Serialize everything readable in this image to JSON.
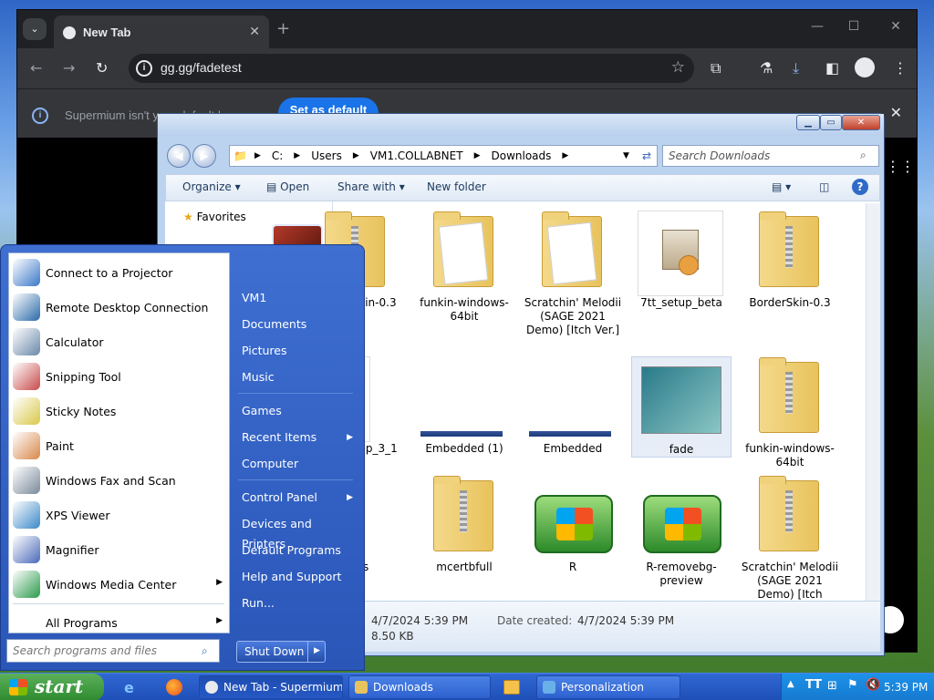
{
  "browser": {
    "tab_title": "New Tab",
    "url": "gg.gg/fadetest",
    "infobar_text": "Supermium isn't your default browser",
    "infobar_button": "Set as default"
  },
  "explorer": {
    "address": [
      "C:",
      "Users",
      "VM1.COLLABNET",
      "Downloads"
    ],
    "search_placeholder": "Search Downloads",
    "commands": {
      "organize": "Organize",
      "open": "Open",
      "share": "Share with",
      "new_folder": "New folder"
    },
    "nav_favorites": "Favorites",
    "files": [
      {
        "name": "BorderSkin-0.3",
        "kind": "zip"
      },
      {
        "name": "funkin-windows-64bit",
        "kind": "pages"
      },
      {
        "name": "Scratchin' Melodii (SAGE 2021 Demo) [Itch Ver.]",
        "kind": "pages"
      },
      {
        "name": "7tt_setup_beta",
        "kind": "setup"
      },
      {
        "name": "BorderSkin-0.3",
        "kind": "zip"
      },
      {
        "name": "ShellSetup_3_1",
        "kind": "shell"
      },
      {
        "name": "Embedded (1)",
        "kind": "bar"
      },
      {
        "name": "Embedded",
        "kind": "bar"
      },
      {
        "name": "fade",
        "kind": "image"
      },
      {
        "name": "funkin-windows-64bit",
        "kind": "zip"
      },
      {
        "name": "ages",
        "kind": "start"
      },
      {
        "name": "mcertbfull",
        "kind": "zip"
      },
      {
        "name": "R",
        "kind": "winlogo"
      },
      {
        "name": "R-removebg-preview",
        "kind": "winlogo"
      },
      {
        "name": "Scratchin' Melodii (SAGE 2021 Demo) [Itch",
        "kind": "zip"
      }
    ],
    "details": {
      "modified": "4/7/2024 5:39 PM",
      "size": "8.50 KB",
      "created_label": "Date created:",
      "created": "4/7/2024 5:39 PM"
    }
  },
  "startmenu": {
    "programs": [
      {
        "label": "Connect to a Projector",
        "color": "#3a78c8"
      },
      {
        "label": "Remote Desktop Connection",
        "color": "#2a6aa8"
      },
      {
        "label": "Calculator",
        "color": "#6a88a8"
      },
      {
        "label": "Snipping Tool",
        "color": "#c84a4a"
      },
      {
        "label": "Sticky Notes",
        "color": "#d8c84a"
      },
      {
        "label": "Paint",
        "color": "#d8884a"
      },
      {
        "label": "Windows Fax and Scan",
        "color": "#7a8a9a"
      },
      {
        "label": "XPS Viewer",
        "color": "#3a88c8"
      },
      {
        "label": "Magnifier",
        "color": "#4a6ab8"
      },
      {
        "label": "Windows Media Center",
        "color": "#2a9a4a"
      }
    ],
    "all_programs": "All Programs",
    "search_placeholder": "Search programs and files",
    "right": [
      "VM1",
      "Documents",
      "Pictures",
      "Music",
      "Games",
      "Recent Items",
      "Computer",
      "Control Panel",
      "Devices and Printers",
      "Default Programs",
      "Help and Support",
      "Run..."
    ],
    "shutdown": "Shut Down"
  },
  "taskbar": {
    "start": "start",
    "buttons": [
      "New Tab - Supermium",
      "Downloads",
      "Personalization"
    ],
    "clock": "5:39 PM"
  }
}
